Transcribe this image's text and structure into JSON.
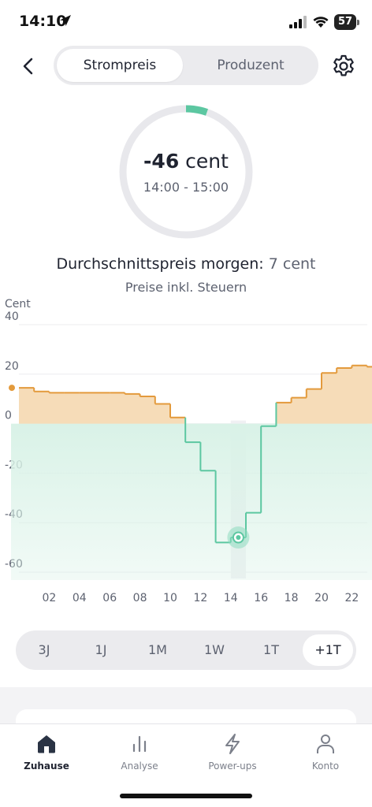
{
  "status_bar": {
    "time": "14:10",
    "battery": "57"
  },
  "header": {
    "segments": [
      {
        "label": "Strompreis",
        "active": true
      },
      {
        "label": "Produzent",
        "active": false
      }
    ]
  },
  "current_price": {
    "value": "-46",
    "unit": "cent",
    "time_range": "14:00 - 15:00"
  },
  "average": {
    "label": "Durchschnittspreis morgen:",
    "value": "7 cent",
    "tax_note": "Preise inkl. Steuern"
  },
  "chart_data": {
    "type": "line",
    "ylabel": "Cent",
    "ylim": [
      -60,
      40
    ],
    "y_ticks": [
      "40",
      "20",
      "0",
      "-20",
      "-40",
      "-60"
    ],
    "x_tick_labels": [
      "02",
      "04",
      "06",
      "08",
      "10",
      "12",
      "14",
      "16",
      "18",
      "20",
      "22"
    ],
    "x_hours": [
      0,
      1,
      2,
      3,
      4,
      5,
      6,
      7,
      8,
      9,
      10,
      11,
      12,
      13,
      14,
      15,
      16,
      17,
      18,
      19,
      20,
      21,
      22,
      23
    ],
    "prices": [
      14.5,
      13,
      12.5,
      12.5,
      12.5,
      12.5,
      12.5,
      12,
      11,
      8,
      2.5,
      -7.5,
      -19,
      -48,
      -46,
      -36,
      -1,
      8.5,
      10.5,
      14,
      20.5,
      22.5,
      23.5,
      23
    ],
    "highlighted_hour": 14,
    "colors": {
      "positive": "#e39a3c",
      "negative": "#5cc7a1",
      "positive_fill": "#f6dcb8",
      "negative_fill": "#d9f2e7",
      "highlight": "#8edbbf"
    }
  },
  "range_selector": {
    "options": [
      {
        "label": "3J",
        "active": false
      },
      {
        "label": "1J",
        "active": false
      },
      {
        "label": "1M",
        "active": false
      },
      {
        "label": "1W",
        "active": false
      },
      {
        "label": "1T",
        "active": false
      },
      {
        "label": "+1T",
        "active": true
      }
    ]
  },
  "tab_bar": {
    "tabs": [
      {
        "label": "Zuhause",
        "icon": "home-icon",
        "active": true
      },
      {
        "label": "Analyse",
        "icon": "bar-chart-icon",
        "active": false
      },
      {
        "label": "Power-ups",
        "icon": "lightning-icon",
        "active": false
      },
      {
        "label": "Konto",
        "icon": "person-icon",
        "active": false
      }
    ]
  }
}
